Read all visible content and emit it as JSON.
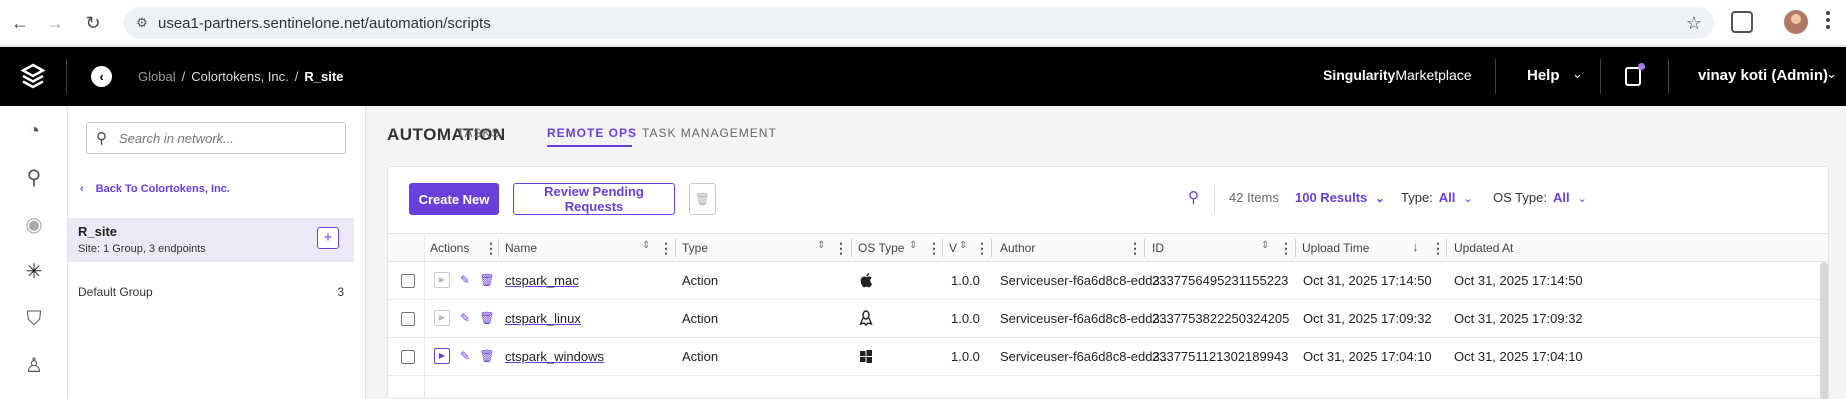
{
  "browser": {
    "url": "usea1-partners.sentinelone.net/automation/scripts",
    "back_icon": "arrow-left-icon",
    "forward_icon": "arrow-right-icon",
    "reload_icon": "reload-icon"
  },
  "header": {
    "breadcrumb": [
      "Global",
      "Colortokens, Inc.",
      "R_site"
    ],
    "marketplace_bold": "Singularity",
    "marketplace_rest": "Marketplace",
    "help_label": "Help",
    "user_label": "vinay koti (Admin)"
  },
  "site_panel": {
    "search_placeholder": "Search in network...",
    "back_label": "Back To Colortokens, Inc.",
    "site_name": "R_site",
    "site_sub": "Site:  1 Group, 3 endpoints",
    "group_name": "Default Group",
    "group_count": "3"
  },
  "main": {
    "title": "AUTOMATION",
    "tabs": [
      "TASKS",
      "REMOTE OPS",
      "TASK MANAGEMENT"
    ],
    "active_tab": "REMOTE OPS"
  },
  "toolbar": {
    "create_label": "Create New",
    "review_label": "Review Pending Requests",
    "items_label": "42 Items",
    "results_label": "100 Results",
    "type_label": "Type:",
    "type_value": "All",
    "os_type_label": "OS Type:",
    "os_type_value": "All"
  },
  "table": {
    "columns": [
      "Actions",
      "Name",
      "Type",
      "OS Type",
      "V",
      "Author",
      "ID",
      "Upload Time",
      "Updated At"
    ],
    "rows": [
      {
        "name": "ctspark_mac",
        "type": "Action",
        "os": "apple-icon",
        "version": "1.0.0",
        "author": "Serviceuser-f6a6d8c8-edd3...",
        "id": "2337756495231155223",
        "upload_time": "Oct 31, 2025 17:14:50",
        "updated_at": "Oct 31, 2025 17:14:50"
      },
      {
        "name": "ctspark_linux",
        "type": "Action",
        "os": "linux-icon",
        "version": "1.0.0",
        "author": "Serviceuser-f6a6d8c8-edd3...",
        "id": "2337753822250324205",
        "upload_time": "Oct 31, 2025 17:09:32",
        "updated_at": "Oct 31, 2025 17:09:32"
      },
      {
        "name": "ctspark_windows",
        "type": "Action",
        "os": "windows-icon",
        "version": "1.0.0",
        "author": "Serviceuser-f6a6d8c8-edd3...",
        "id": "2337751121302189943",
        "upload_time": "Oct 31, 2025 17:04:10",
        "updated_at": "Oct 31, 2025 17:04:10"
      }
    ]
  },
  "colors": {
    "accent": "#6b3fd9",
    "header_bg": "#000000"
  }
}
